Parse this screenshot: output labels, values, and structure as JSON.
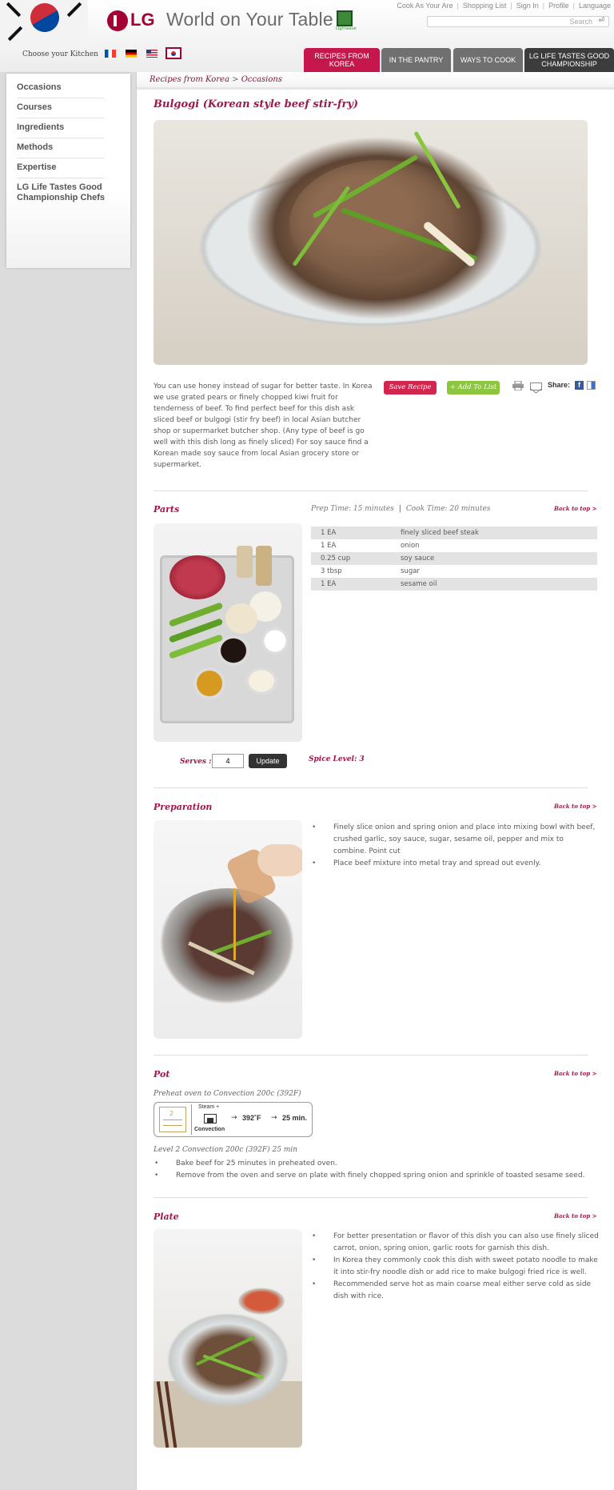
{
  "header": {
    "logo_text": "LG",
    "site_title": "World on Your Table",
    "lgtv_caption": "LIghtwave",
    "top_links": [
      "Cook As Your Are",
      "Shopping List",
      "Sign In",
      "Profile",
      "Language"
    ],
    "search_placeholder": "Search",
    "choose_kitchen": "Choose your Kitchen",
    "tabs": [
      {
        "label": "RECIPES FROM KOREA"
      },
      {
        "label": "IN THE PANTRY"
      },
      {
        "label": "WAYS TO COOK"
      },
      {
        "label": "LG LIFE TASTES GOOD CHAMPIONSHIP"
      }
    ]
  },
  "sidebar": {
    "items": [
      {
        "label": "Occasions"
      },
      {
        "label": "Courses"
      },
      {
        "label": "Ingredients"
      },
      {
        "label": "Methods"
      },
      {
        "label": "Expertise"
      },
      {
        "label": "LG Life Tastes Good Championship Chefs"
      }
    ]
  },
  "breadcrumb": {
    "root": "Recipes from Korea",
    "separator": ">",
    "current": "Occasions"
  },
  "recipe": {
    "title": "Bulgogi (Korean style beef stir-fry)",
    "intro": "You can use honey instead of sugar for better taste. In Korea we use grated pears or finely chopped kiwi fruit for tenderness of beef. To find perfect beef for this dish ask sliced beef or bulgogi (stir fry beef) in local Asian butcher shop or supermarket butcher shop. (Any type of beef is go well with this dish long as finely sliced) For soy sauce find a Korean made soy sauce from local Asian grocery store or supermarket.",
    "save_label": "Save Recipe",
    "add_list_label": "+ Add To List",
    "share_label": "Share:"
  },
  "parts": {
    "title": "Parts",
    "prep_time": "Prep Time: 15 minutes",
    "time_separator": "|",
    "cook_time": "Cook Time: 20 minutes",
    "back_to_top": "Back to top >",
    "ingredients": [
      {
        "amount": "1 EA",
        "name": "finely sliced beef steak"
      },
      {
        "amount": "1 EA",
        "name": "onion"
      },
      {
        "amount": "0.25 cup",
        "name": "soy sauce"
      },
      {
        "amount": "3 tbsp",
        "name": "sugar"
      },
      {
        "amount": "1 EA",
        "name": "sesame oil"
      }
    ],
    "serves_label": "Serves :",
    "serves_value": "4",
    "update_label": "Update",
    "spice_level": "Spice Level: 3"
  },
  "preparation": {
    "title": "Preparation",
    "back_to_top": "Back to top >",
    "steps": [
      "Finely slice onion and spring onion and place into mixing bowl with beef, crushed garlic, soy sauce, sugar, sesame oil, pepper and mix to combine. Point cut",
      "Place beef mixture into metal tray and spread out evenly."
    ]
  },
  "pot": {
    "title": "Pot",
    "back_to_top": "Back to top >",
    "preheat": "Preheat oven to Convection 200c (392F)",
    "oven_level": "2",
    "oven_mode_top": "Steam +",
    "oven_mode_bottom": "Convection",
    "arrow": "→",
    "oven_temp": "392˚F",
    "oven_time": "25 min.",
    "level_note": "Level 2 Convection 200c (392F) 25 min",
    "steps": [
      "Bake beef for 25 minutes in preheated oven.",
      "Remove from the oven and serve on plate with finely chopped spring onion and sprinkle of toasted sesame seed."
    ]
  },
  "plate": {
    "title": "Plate",
    "back_to_top": "Back to top >",
    "tips": [
      "For better presentation or flavor of this dish you can also use finely sliced carrot, onion, spring onion, garlic roots for garnish this dish.",
      "In Korea they commonly cook this dish with sweet potato noodle to make it into stir-fry noodle dish or add rice to make bulgogi fried rice is well.",
      "Recommended serve hot as main coarse meal either serve cold as side dish with rice."
    ]
  },
  "colors": {
    "brand": "#a50034",
    "accent_tab": "#c5174c",
    "save_button": "#d3264f",
    "add_button": "#8cc63f"
  }
}
